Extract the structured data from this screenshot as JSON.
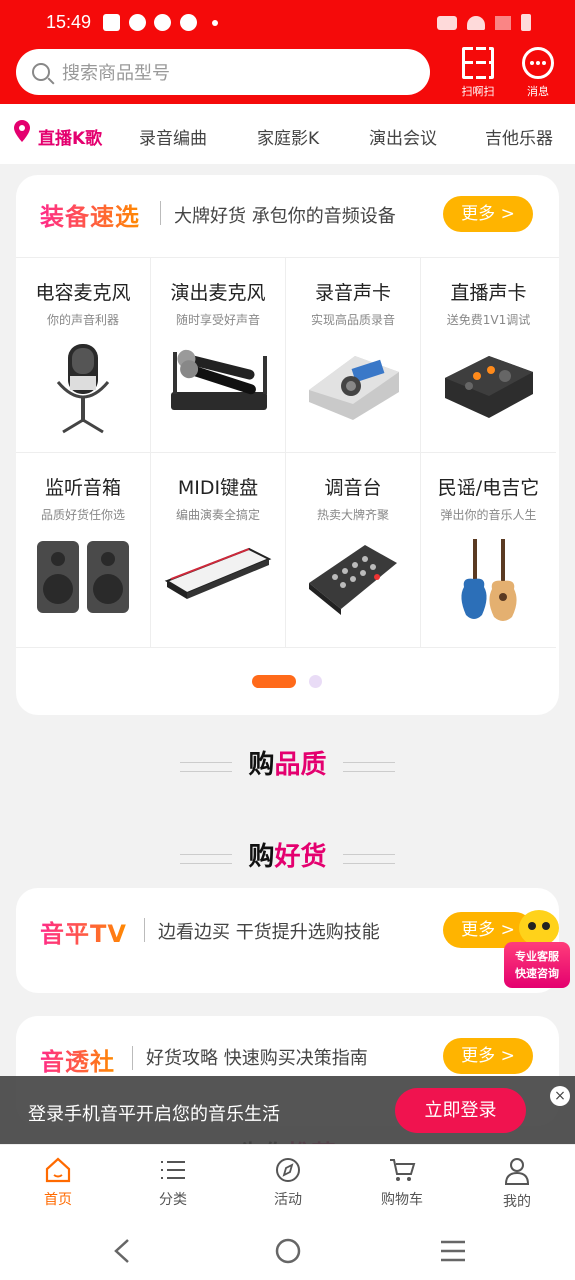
{
  "status_bar": {
    "time": "15:49"
  },
  "header": {
    "search_placeholder": "搜索商品型号",
    "scan_label": "扫啊扫",
    "message_label": "消息"
  },
  "categories": [
    {
      "label": "直播K歌",
      "active": true
    },
    {
      "label": "录音编曲",
      "active": false
    },
    {
      "label": "家庭影K",
      "active": false
    },
    {
      "label": "演出会议",
      "active": false
    },
    {
      "label": "吉他乐器",
      "active": false
    }
  ],
  "equipment_section": {
    "title": "装备速选",
    "subtitle": "大牌好货 承包你的音频设备",
    "more_label": "更多 >",
    "items": [
      {
        "title": "电容麦克风",
        "subtitle": "你的声音利器",
        "icon": "condenser-mic-icon"
      },
      {
        "title": "演出麦克风",
        "subtitle": "随时享受好声音",
        "icon": "wireless-mic-icon"
      },
      {
        "title": "录音声卡",
        "subtitle": "实现高品质录音",
        "icon": "recording-interface-icon"
      },
      {
        "title": "直播声卡",
        "subtitle": "送免费1V1调试",
        "icon": "live-soundcard-icon"
      },
      {
        "title": "监听音箱",
        "subtitle": "品质好货任你选",
        "icon": "monitor-speaker-icon"
      },
      {
        "title": "MIDI键盘",
        "subtitle": "编曲演奏全搞定",
        "icon": "midi-keyboard-icon"
      },
      {
        "title": "调音台",
        "subtitle": "热卖大牌齐聚",
        "icon": "mixer-icon"
      },
      {
        "title": "民谣/电吉它",
        "subtitle": "弹出你的音乐人生",
        "icon": "guitar-icon"
      }
    ]
  },
  "sections": {
    "quality": {
      "prefix": "购",
      "highlight": "品质"
    },
    "goods": {
      "prefix": "购",
      "highlight": "好货"
    },
    "partial": {
      "prefix": "为你",
      "highlight": "推荐"
    }
  },
  "promo_cards": [
    {
      "title": "音平TV",
      "subtitle": "边看边买 干货提升选购技能",
      "more_label": "更多 >"
    },
    {
      "title": "音透社",
      "subtitle": "好货攻略 快速购买决策指南",
      "more_label": "更多 >"
    }
  ],
  "customer_service": {
    "line1": "专业客服",
    "line2": "快速咨询"
  },
  "login_banner": {
    "text": "登录手机音平开启您的音乐生活",
    "button": "立即登录",
    "close": "×"
  },
  "bottom_nav": [
    {
      "label": "首页",
      "icon": "home-icon",
      "active": true
    },
    {
      "label": "分类",
      "icon": "list-icon",
      "active": false
    },
    {
      "label": "活动",
      "icon": "compass-icon",
      "active": false
    },
    {
      "label": "购物车",
      "icon": "cart-icon",
      "active": false
    },
    {
      "label": "我的",
      "icon": "user-icon",
      "active": false
    }
  ],
  "colors": {
    "brand_red": "#f50a0a",
    "accent_pink": "#e4006f",
    "more_orange": "#ffb400",
    "nav_active": "#ff6a00"
  }
}
